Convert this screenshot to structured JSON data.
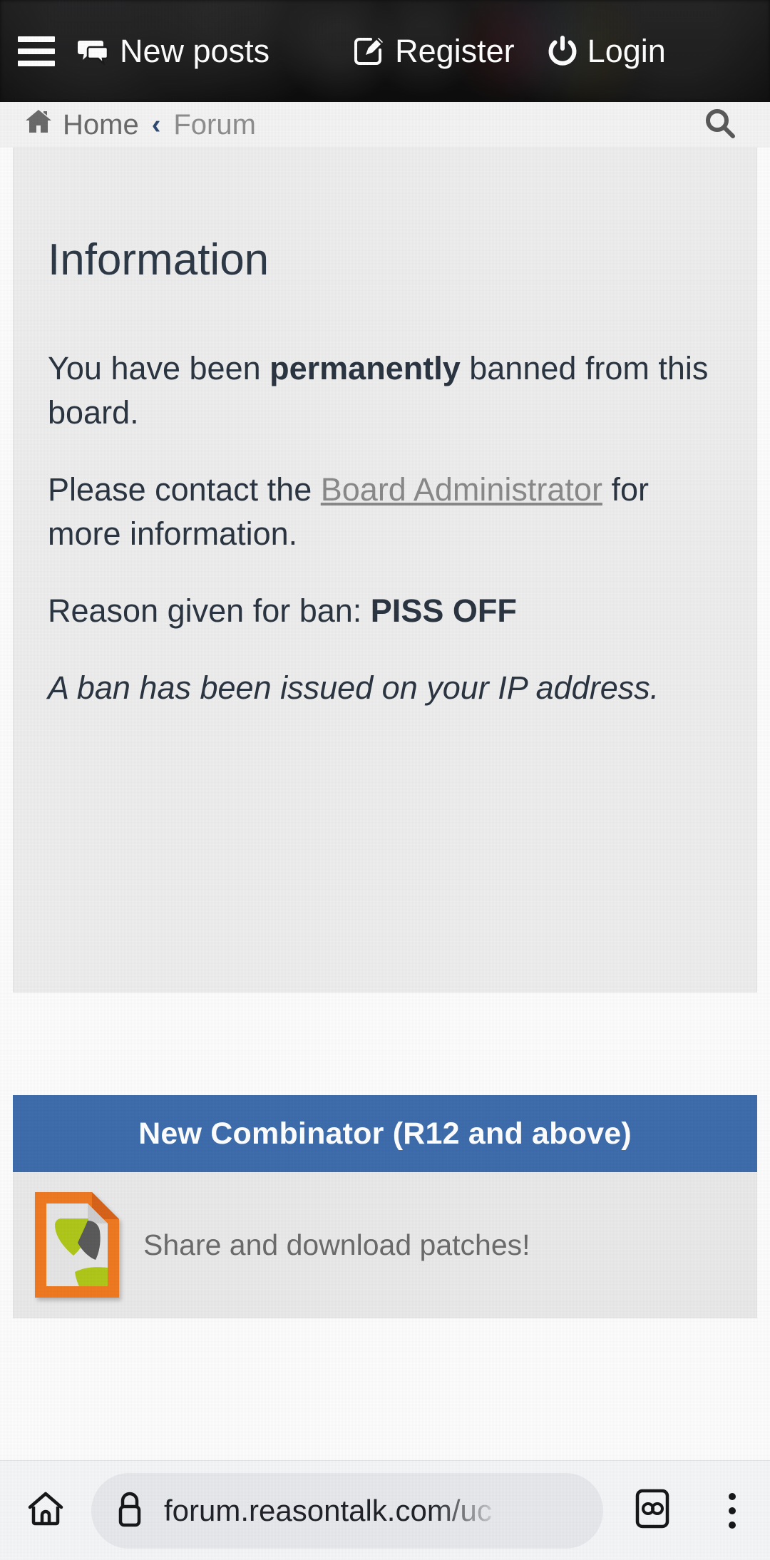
{
  "navbar": {
    "menu_icon": "hamburger-menu-icon",
    "items": [
      {
        "label": "New posts",
        "icon": "comments-icon"
      },
      {
        "label": "Register",
        "icon": "pencil-square-icon"
      },
      {
        "label": "Login",
        "icon": "power-icon"
      }
    ]
  },
  "breadcrumb": {
    "home_label": "Home",
    "separator": "‹",
    "current_label": "Forum",
    "home_icon": "house-icon",
    "search_icon": "search-icon"
  },
  "panel": {
    "title": "Information",
    "line1_pre": "You have been ",
    "line1_bold": "permanently",
    "line1_post": " banned from this board.",
    "line2_pre": "Please contact the ",
    "line2_link": "Board Administrator",
    "line2_post": " for more information.",
    "line3_pre": "Reason given for ban: ",
    "line3_bold": "PISS OFF",
    "line4_italic": "A ban has been issued on your IP address."
  },
  "promo": {
    "heading": "New Combinator (R12 and above)",
    "caption": "Share and download patches!",
    "icon": "file-document-icon",
    "heading_bg": "#3f6dac",
    "icon_colors": {
      "frame": "#f07a22",
      "paper": "#e3e3e3",
      "green": "#b0c81a",
      "gray": "#5b5b5b"
    }
  },
  "browser": {
    "home_icon": "home-icon",
    "lock_icon": "lock-icon",
    "url": "forum.reasontalk.com/uc",
    "tabs_icon": "tab-count-icon",
    "tabs_label": "∞",
    "menu_icon": "overflow-menu-icon"
  }
}
